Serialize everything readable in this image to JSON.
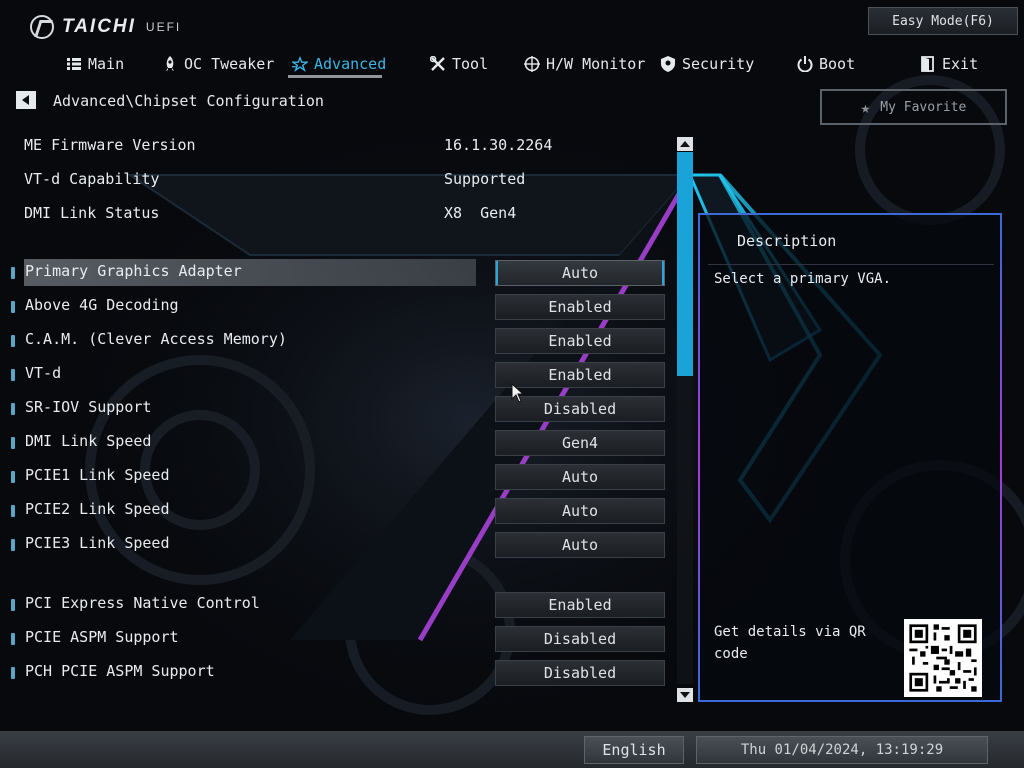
{
  "brand": {
    "name": "TAICHI",
    "sub": "UEFI"
  },
  "easy_mode": {
    "label": "Easy Mode(F6)"
  },
  "nav": {
    "tabs": [
      {
        "label": "Main",
        "icon": "list-icon"
      },
      {
        "label": "OC Tweaker",
        "icon": "rocket-icon"
      },
      {
        "label": "Advanced",
        "icon": "star-icon",
        "active": true
      },
      {
        "label": "Tool",
        "icon": "tools-icon"
      },
      {
        "label": "H/W Monitor",
        "icon": "monitor-icon"
      },
      {
        "label": "Security",
        "icon": "shield-icon"
      },
      {
        "label": "Boot",
        "icon": "power-icon"
      },
      {
        "label": "Exit",
        "icon": "exit-icon"
      }
    ]
  },
  "breadcrumb": {
    "path": "Advanced\\Chipset Configuration"
  },
  "favorite": {
    "label": "My Favorite"
  },
  "info": [
    {
      "label": "ME Firmware Version",
      "value": "16.1.30.2264"
    },
    {
      "label": "VT-d Capability",
      "value": "Supported"
    },
    {
      "label": "DMI Link Status",
      "value": "X8  Gen4"
    }
  ],
  "settings": [
    {
      "label": "Primary Graphics Adapter",
      "value": "Auto",
      "selected": true
    },
    {
      "label": "Above 4G Decoding",
      "value": "Enabled"
    },
    {
      "label": "C.A.M. (Clever Access Memory)",
      "value": "Enabled"
    },
    {
      "label": "VT-d",
      "value": "Enabled"
    },
    {
      "label": "SR-IOV Support",
      "value": "Disabled"
    },
    {
      "label": "DMI Link Speed",
      "value": "Gen4"
    },
    {
      "label": "PCIE1 Link Speed",
      "value": "Auto"
    },
    {
      "label": "PCIE2 Link Speed",
      "value": "Auto"
    },
    {
      "label": "PCIE3 Link Speed",
      "value": "Auto"
    },
    {
      "label": "PCI Express Native Control",
      "value": "Enabled"
    },
    {
      "label": "PCIE ASPM Support",
      "value": "Disabled"
    },
    {
      "label": "PCH PCIE ASPM Support",
      "value": "Disabled"
    }
  ],
  "description": {
    "title": "Description",
    "text": "Select a primary VGA.",
    "qr_text": "Get details via QR code"
  },
  "footer": {
    "language": "English",
    "datetime": "Thu 01/04/2024, 13:19:29"
  },
  "colors": {
    "accent": "#3ab6e6",
    "scroll_thumb": "#1aa3d8",
    "panel_border": "#a63ad6"
  }
}
